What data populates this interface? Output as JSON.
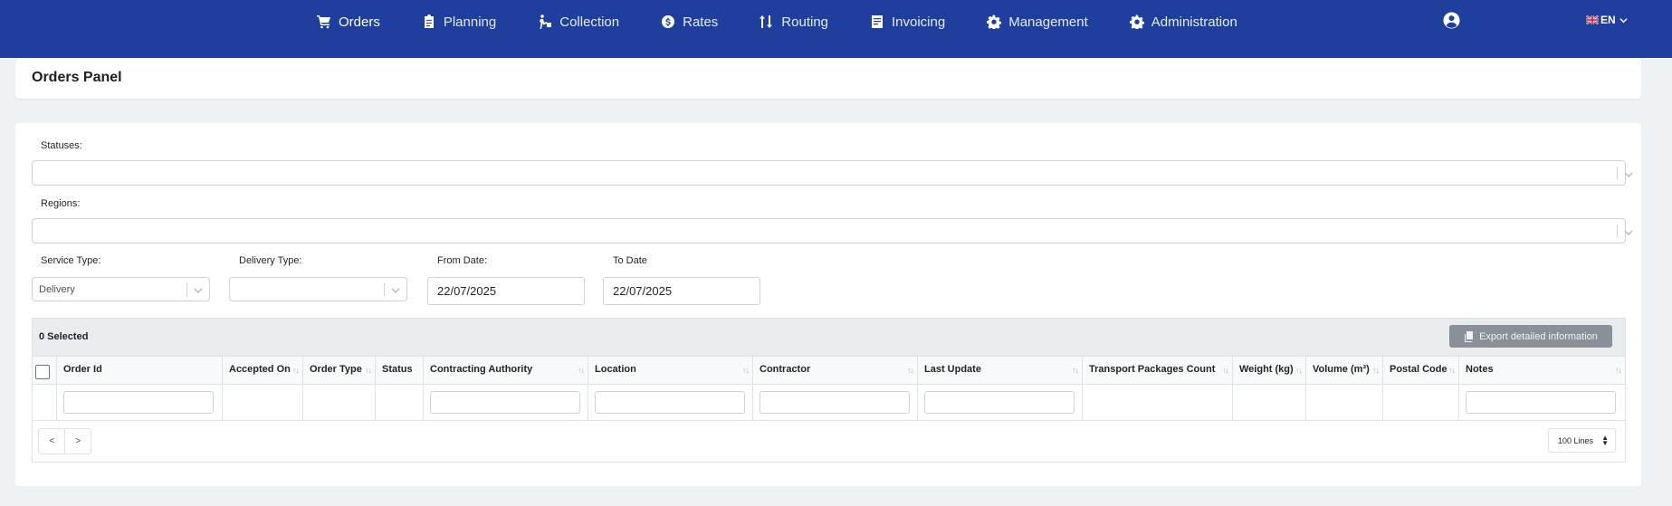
{
  "nav": {
    "items": [
      {
        "label": "Orders",
        "icon": "cart-icon",
        "active": true
      },
      {
        "label": "Planning",
        "icon": "clipboard-icon",
        "active": false
      },
      {
        "label": "Collection",
        "icon": "person-carry-icon",
        "active": false
      },
      {
        "label": "Rates",
        "icon": "dollar-circle-icon",
        "active": false
      },
      {
        "label": "Routing",
        "icon": "route-arrows-icon",
        "active": false
      },
      {
        "label": "Invoicing",
        "icon": "invoice-icon",
        "active": false
      },
      {
        "label": "Management",
        "icon": "gear-icon",
        "active": false
      },
      {
        "label": "Administration",
        "icon": "gear-icon",
        "active": false
      }
    ],
    "language": "EN"
  },
  "page": {
    "title": "Orders Panel"
  },
  "filters": {
    "statuses_label": "Statuses:",
    "regions_label": "Regions:",
    "service_type_label": "Service Type:",
    "service_type_value": "Delivery",
    "delivery_type_label": "Delivery Type:",
    "delivery_type_value": "",
    "from_date_label": "From Date:",
    "from_date_value": "22/07/2025",
    "to_date_label": "To Date",
    "to_date_value": "22/07/2025"
  },
  "table": {
    "selected_text": "0 Selected",
    "export_label": "Export detailed information",
    "columns": [
      "Order Id",
      "Accepted On",
      "Order Type",
      "Status",
      "Contracting Authority",
      "Location",
      "Contractor",
      "Last Update",
      "Transport Packages Count",
      "Weight (kg)",
      "Volume (m³)",
      "Postal Code",
      "Notes"
    ],
    "pager_prev": "<",
    "pager_next": ">",
    "lines_label": "100 Lines"
  },
  "colors": {
    "brand": "#1f3f9f",
    "export_button": "#8a9097"
  }
}
